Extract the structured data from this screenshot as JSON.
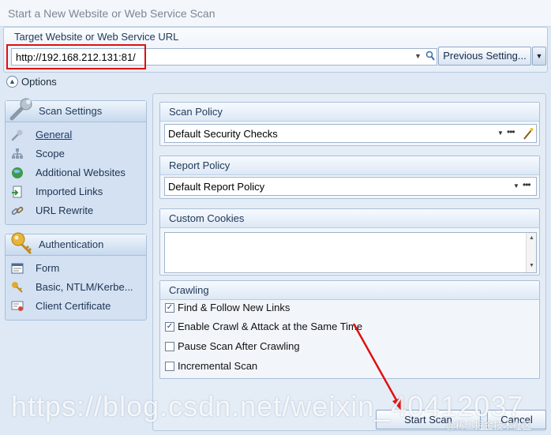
{
  "window": {
    "title": "Start a New Website or Web Service Scan"
  },
  "url_panel": {
    "label": "Target Website or Web Service URL",
    "url_value": "http://192.168.212.131:81/",
    "previous_settings_label": "Previous Setting..."
  },
  "options": {
    "label": "Options"
  },
  "scan_settings": {
    "title": "Scan Settings",
    "items": [
      {
        "label": "General",
        "icon": "wrench-icon"
      },
      {
        "label": "Scope",
        "icon": "sitemap-icon"
      },
      {
        "label": "Additional Websites",
        "icon": "globe-icon"
      },
      {
        "label": "Imported Links",
        "icon": "import-icon"
      },
      {
        "label": "URL Rewrite",
        "icon": "link-icon"
      }
    ]
  },
  "authentication": {
    "title": "Authentication",
    "items": [
      {
        "label": "Form",
        "icon": "form-icon"
      },
      {
        "label": "Basic, NTLM/Kerbe...",
        "icon": "key-icon"
      },
      {
        "label": "Client Certificate",
        "icon": "certificate-icon"
      }
    ]
  },
  "scan_policy": {
    "title": "Scan Policy",
    "value": "Default Security Checks"
  },
  "report_policy": {
    "title": "Report Policy",
    "value": "Default Report Policy"
  },
  "custom_cookies": {
    "title": "Custom Cookies"
  },
  "crawling": {
    "title": "Crawling",
    "options": [
      {
        "label": "Find & Follow New Links",
        "checked": true
      },
      {
        "label": "Enable Crawl & Attack at the Same Time",
        "checked": true
      },
      {
        "label": "Pause Scan After Crawling",
        "checked": false
      },
      {
        "label": "Incremental Scan",
        "checked": false
      }
    ]
  },
  "buttons": {
    "start_scan": "Start Scan",
    "cancel": "Cancel"
  },
  "watermark": {
    "main": "https://blog.csdn.net/weixin_40412037",
    "secondary": "@稀土掘金技术社区"
  }
}
